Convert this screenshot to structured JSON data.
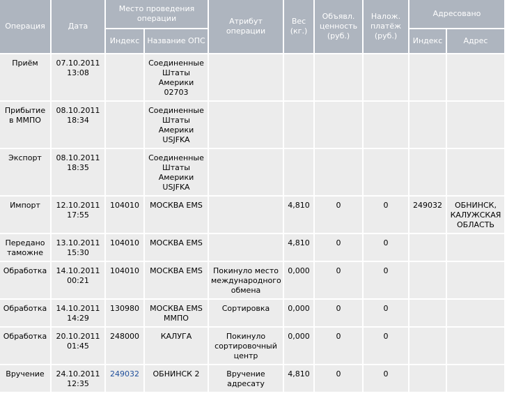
{
  "headers": {
    "operation": "Операция",
    "date": "Дата",
    "place": "Место проведения операции",
    "place_index": "Индекс",
    "place_name": "Название ОПС",
    "attribute": "Атрибут операции",
    "weight": "Вес (кг.)",
    "declared_value": "Объявл. ценность (руб.)",
    "cod": "Налож. платёж (руб.)",
    "addressed": "Адресовано",
    "addr_index": "Индекс",
    "addr_address": "Адрес"
  },
  "rows": [
    {
      "operation": "Приём",
      "date": "07.10.2011 13:08",
      "index": "",
      "ops": "Соединенные Штаты Америки 02703",
      "attribute": "",
      "weight": "",
      "value": "",
      "cod": "",
      "addr_index": "",
      "address": ""
    },
    {
      "operation": "Прибытие в ММПО",
      "date": "08.10.2011 18:34",
      "index": "",
      "ops": "Соединенные Штаты Америки USJFKA",
      "attribute": "",
      "weight": "",
      "value": "",
      "cod": "",
      "addr_index": "",
      "address": ""
    },
    {
      "operation": "Экспорт",
      "date": "08.10.2011 18:35",
      "index": "",
      "ops": "Соединенные Штаты Америки USJFKA",
      "attribute": "",
      "weight": "",
      "value": "",
      "cod": "",
      "addr_index": "",
      "address": ""
    },
    {
      "operation": "Импорт",
      "date": "12.10.2011 17:55",
      "index": "104010",
      "ops": "МОСКВА EMS",
      "attribute": "",
      "weight": "4,810",
      "value": "0",
      "cod": "0",
      "addr_index": "249032",
      "address": "ОБНИНСК, КАЛУЖСКАЯ ОБЛАСТЬ"
    },
    {
      "operation": "Передано таможне",
      "date": "13.10.2011 15:30",
      "index": "104010",
      "ops": "МОСКВА EMS",
      "attribute": "",
      "weight": "4,810",
      "value": "0",
      "cod": "0",
      "addr_index": "",
      "address": ""
    },
    {
      "operation": "Обработка",
      "date": "14.10.2011 00:21",
      "index": "104010",
      "ops": "МОСКВА EMS",
      "attribute": "Покинуло место международного обмена",
      "weight": "0,000",
      "value": "0",
      "cod": "0",
      "addr_index": "",
      "address": ""
    },
    {
      "operation": "Обработка",
      "date": "14.10.2011 14:29",
      "index": "130980",
      "ops": "МОСКВА EMS ММПО",
      "attribute": "Сортировка",
      "weight": "0,000",
      "value": "0",
      "cod": "0",
      "addr_index": "",
      "address": ""
    },
    {
      "operation": "Обработка",
      "date": "20.10.2011 01:45",
      "index": "248000",
      "ops": "КАЛУГА",
      "attribute": "Покинуло сортировочный центр",
      "weight": "0,000",
      "value": "0",
      "cod": "0",
      "addr_index": "",
      "address": ""
    },
    {
      "operation": "Вручение",
      "date": "24.10.2011 12:35",
      "index": "249032",
      "ops": "ОБНИНСК 2",
      "attribute": "Вручение адресату",
      "weight": "4,810",
      "value": "0",
      "cod": "0",
      "addr_index": "",
      "address": "",
      "index_is_link": true
    }
  ],
  "colors": {
    "header_bg": "#aeb5bf",
    "cell_bg": "#ececec",
    "link": "#1f4f9b"
  }
}
